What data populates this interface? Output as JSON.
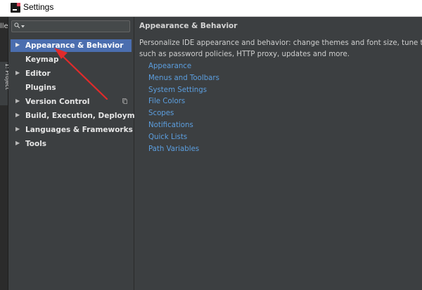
{
  "window": {
    "title": "Settings"
  },
  "ide_strip": {
    "chars": "lle",
    "project_tab": "1: Project"
  },
  "search": {
    "value": "",
    "placeholder": ""
  },
  "tree": {
    "items": [
      {
        "label": "Appearance & Behavior",
        "expandable": true,
        "selected": true
      },
      {
        "label": "Keymap",
        "expandable": false,
        "selected": false
      },
      {
        "label": "Editor",
        "expandable": true,
        "selected": false
      },
      {
        "label": "Plugins",
        "expandable": false,
        "selected": false
      },
      {
        "label": "Version Control",
        "expandable": true,
        "selected": false,
        "has_copy_icon": true
      },
      {
        "label": "Build, Execution, Deployment",
        "expandable": true,
        "selected": false
      },
      {
        "label": "Languages & Frameworks",
        "expandable": true,
        "selected": false
      },
      {
        "label": "Tools",
        "expandable": true,
        "selected": false
      }
    ]
  },
  "content": {
    "heading": "Appearance & Behavior",
    "description_line1": "Personalize IDE appearance and behavior: change themes and font size, tune the keym",
    "description_line2": "such as password policies, HTTP proxy, updates and more.",
    "links": [
      "Appearance",
      "Menus and Toolbars",
      "System Settings",
      "File Colors",
      "Scopes",
      "Notifications",
      "Quick Lists",
      "Path Variables"
    ]
  },
  "colors": {
    "background": "#3c3f41",
    "selection": "#4b6eaf",
    "link": "#5c9fe0",
    "annotation_arrow": "#e02b2b"
  }
}
